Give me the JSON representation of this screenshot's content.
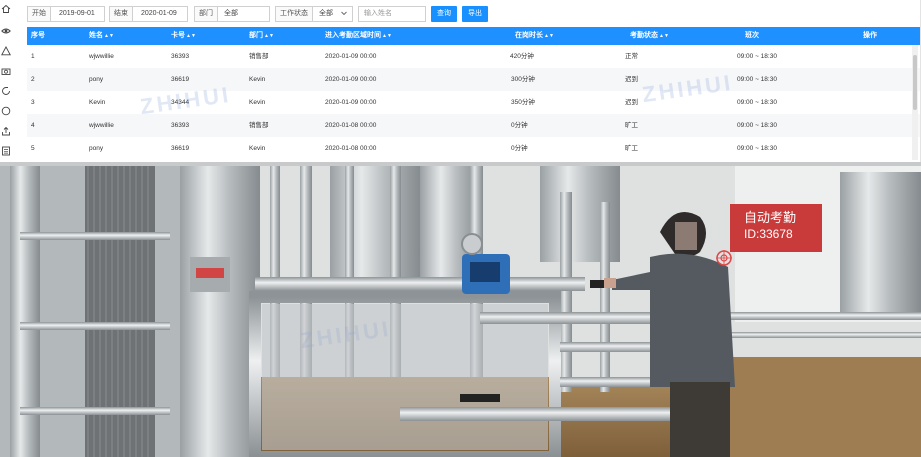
{
  "filters": {
    "start_label": "开始",
    "start_value": "2019-09-01",
    "end_label": "结束",
    "end_value": "2020-01-09",
    "dept_label": "部门",
    "dept_value": "全部",
    "status_label": "工作状态",
    "status_value": "全部",
    "name_placeholder": "输入姓名",
    "query_label": "查询",
    "export_label": "导出"
  },
  "table": {
    "columns": [
      "序号",
      "姓名",
      "卡号",
      "部门",
      "进入考勤区域时间",
      "在岗时长",
      "考勤状态",
      "班次",
      "操作"
    ],
    "rows": [
      [
        "1",
        "wjwwillie",
        "36393",
        "销售部",
        "2020-01-09 00:00",
        "420分钟",
        "正常",
        "09:00 ~ 18:30",
        ""
      ],
      [
        "2",
        "pony",
        "36619",
        "Kevin",
        "2020-01-09 00:00",
        "300分钟",
        "迟到",
        "09:00 ~ 18:30",
        ""
      ],
      [
        "3",
        "Kevin",
        "34344",
        "Kevin",
        "2020-01-09 00:00",
        "350分钟",
        "迟到",
        "09:00 ~ 18:30",
        ""
      ],
      [
        "4",
        "wjwwillie",
        "36393",
        "销售部",
        "2020-01-08 00:00",
        "0分钟",
        "旷工",
        "09:00 ~ 18:30",
        ""
      ],
      [
        "5",
        "pony",
        "36619",
        "Kevin",
        "2020-01-08 00:00",
        "0分钟",
        "旷工",
        "09:00 ~ 18:30",
        ""
      ]
    ]
  },
  "badge": {
    "title": "自动考勤",
    "id_text": "ID:33678"
  },
  "colors": {
    "accent": "#1e90ff",
    "badge": "#c93b3b"
  }
}
